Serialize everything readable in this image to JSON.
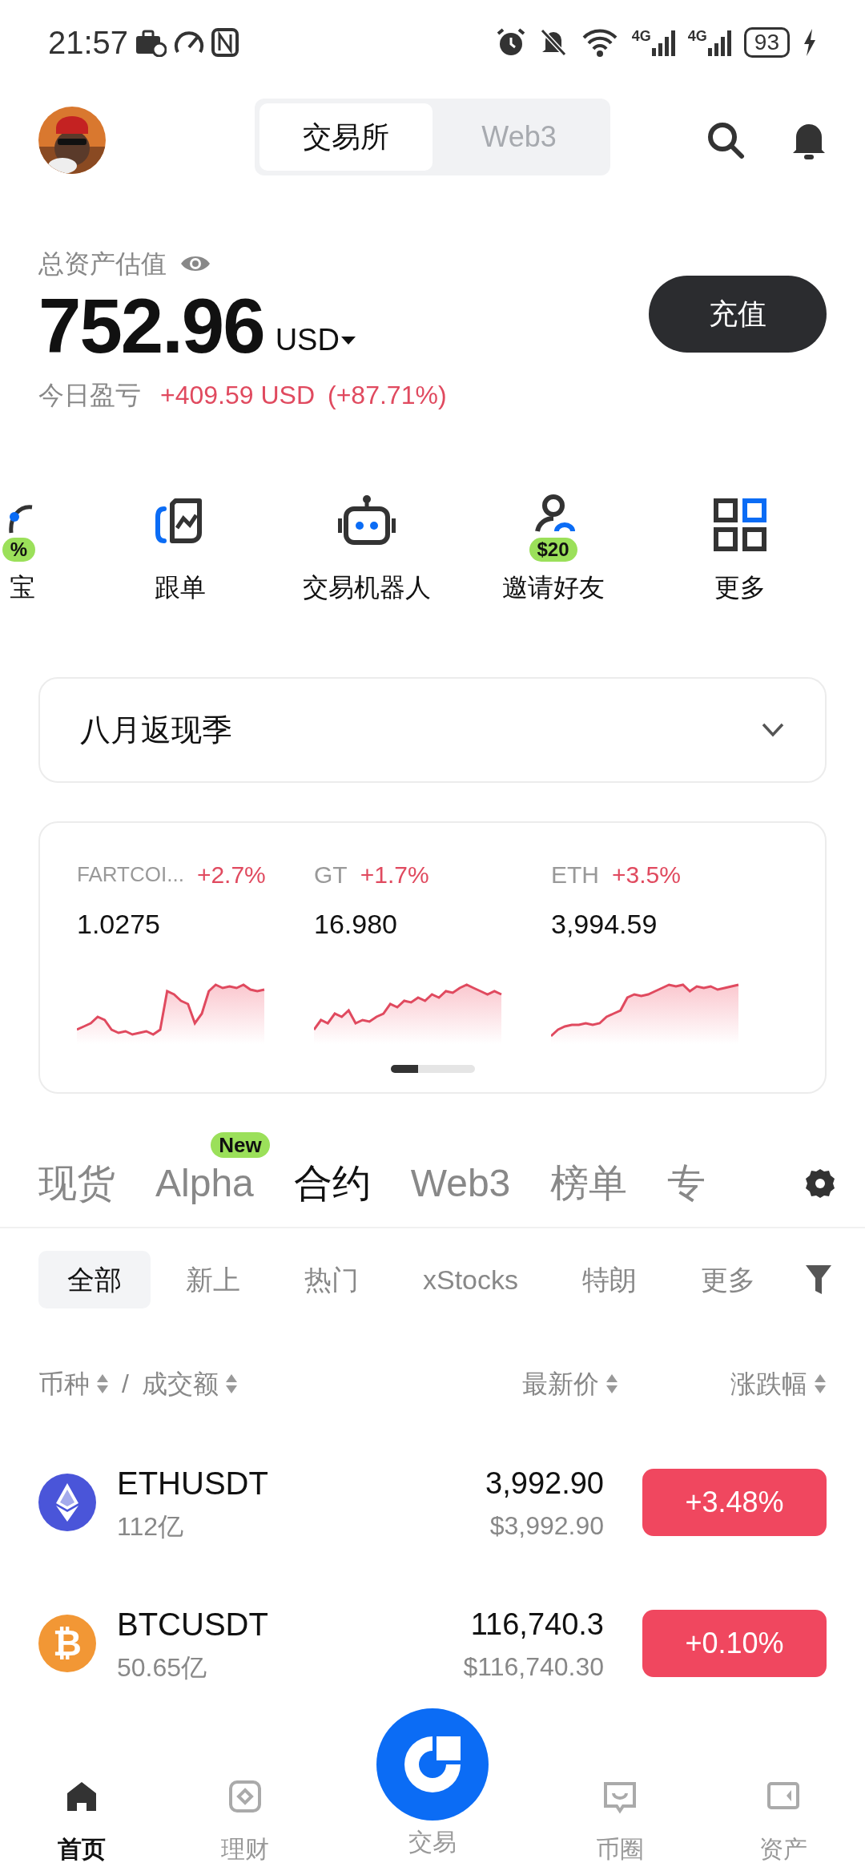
{
  "status_bar": {
    "time": "21:57",
    "network": [
      "4G",
      "4G"
    ],
    "battery": "93"
  },
  "header": {
    "segments": [
      {
        "label": "交易所",
        "selected": true
      },
      {
        "label": "Web3",
        "selected": false
      }
    ]
  },
  "assets": {
    "label": "总资产估值",
    "amount": "752.96",
    "currency": "USD",
    "deposit_button": "充值",
    "pnl_label": "今日盈亏",
    "pnl_value": "+409.59 USD",
    "pnl_percent": "(+87.71%)"
  },
  "shortcuts": [
    {
      "kind": "earn",
      "label": "宝",
      "badge": "%"
    },
    {
      "kind": "copy",
      "label": "跟单"
    },
    {
      "kind": "bot",
      "label": "交易机器人"
    },
    {
      "kind": "invite",
      "label": "邀请好友",
      "badge": "$20"
    },
    {
      "kind": "more",
      "label": "更多"
    }
  ],
  "promo": {
    "title": "八月返现季",
    "expanded": false
  },
  "tickers": [
    {
      "name": "FARTCOI...",
      "change": "+2.7%",
      "price": "1.0275"
    },
    {
      "name": "GT",
      "change": "+1.7%",
      "price": "16.980"
    },
    {
      "name": "ETH",
      "change": "+3.5%",
      "price": "3,994.59"
    }
  ],
  "ticker_pager": {
    "level": 0.33
  },
  "market_tabs": [
    {
      "label": "现货",
      "selected": false
    },
    {
      "label": "Alpha",
      "selected": false,
      "badge": "New"
    },
    {
      "label": "合约",
      "selected": true
    },
    {
      "label": "Web3",
      "selected": false
    },
    {
      "label": "榜单",
      "selected": false
    },
    {
      "label": "专",
      "selected": false
    }
  ],
  "filters": [
    {
      "label": "全部",
      "selected": true
    },
    {
      "label": "新上",
      "selected": false
    },
    {
      "label": "热门",
      "selected": false
    },
    {
      "label": "xStocks",
      "selected": false
    },
    {
      "label": "特朗",
      "selected": false
    },
    {
      "label": "更多",
      "selected": false
    }
  ],
  "table": {
    "columns": [
      "币种",
      "/",
      "成交额",
      "最新价",
      "涨跌幅"
    ],
    "rows": [
      {
        "kind": "eth",
        "symbol": "ETHUSDT",
        "volume": "112亿",
        "price": "3,992.90",
        "price_usd": "$3,992.90",
        "change": "+3.48%"
      },
      {
        "kind": "btc",
        "glyph": "₿",
        "symbol": "BTCUSDT",
        "volume": "50.65亿",
        "price": "116,740.3",
        "price_usd": "$116,740.30",
        "change": "+0.10%"
      }
    ]
  },
  "bottom_nav": [
    {
      "kind": "home",
      "label": "首页",
      "selected": true
    },
    {
      "kind": "finance",
      "label": "理财",
      "selected": false
    },
    {
      "kind": "trade",
      "label": "交易",
      "selected": false
    },
    {
      "kind": "feed",
      "label": "币圈",
      "selected": false
    },
    {
      "kind": "assets",
      "label": "资产",
      "selected": false
    }
  ]
}
